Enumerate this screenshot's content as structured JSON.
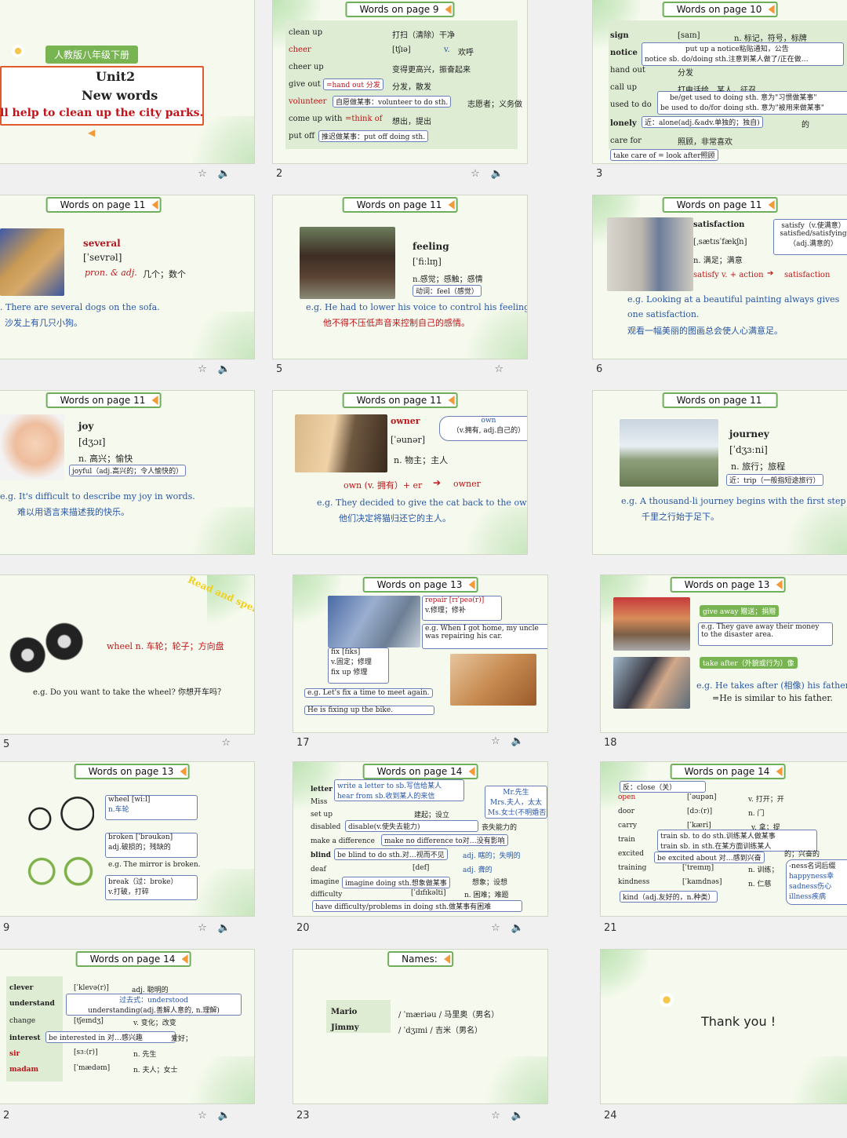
{
  "slides": {
    "s1": {
      "publisher": "人教版八年级下册",
      "unit": "Unit2",
      "sub": "New words",
      "headline": "ll help to clean up the city parks."
    },
    "s2": {
      "title": "Words on page 9",
      "num": "2",
      "w1": "clean up",
      "m1": "打扫（清除）干净",
      "w2": "cheer",
      "p2": "[tʃɪə]",
      "m2a": "v.",
      "m2": "欢呼",
      "w3": "cheer up",
      "m3": "变得更高兴，振奋起来",
      "w4": "give out",
      "b4": "=hand out 分发",
      "m4": "分发，散发",
      "w5": "volunteer",
      "b5": "自愿做某事：volunteer to do sth.",
      "m5": "志愿者；义务做",
      "w6": "come up with",
      "b6": "=think of",
      "m6": "想出，提出",
      "w7": "put off",
      "b7": "推迟做某事：put off doing sth."
    },
    "s3": {
      "title": "Words on page 10",
      "num": "3",
      "w1": "sign",
      "p1": "[saɪn]",
      "m1": "n. 标记，符号，标牌",
      "w2": "notice",
      "b2a": "put up a notice粘贴通知，公告",
      "b2b": "notice sb. do/doing sth.注意到某人做了/正在做…",
      "w3": "hand out",
      "m3": "分发",
      "w4": "call up",
      "m4": "打电话给…某人，征召",
      "w5": "used to do",
      "b5a": "be/get used to doing sth. 意为\"习惯做某事\"",
      "b5b": "be used to do/for doing sth. 意为\"被用来做某事\"",
      "w6": "lonely",
      "b6": "近：alone(adj.&adv.单独的；独自)",
      "m6": "的",
      "w7": "care for",
      "m7": "照顾，非常喜欢",
      "b8": "take care of = look after照顾"
    },
    "s4": {
      "title": "Words on page 11",
      "num": "",
      "word": "several",
      "phon": "[ˈsevrəl]",
      "pos": "pron. & adj.",
      "mean": "几个；数个",
      "eg": ". There are several dogs on the sofa.",
      "cn": "沙发上有几只小狗。"
    },
    "s5": {
      "title": "Words on page 11",
      "num": "5",
      "word": "feeling",
      "phon": "[ˈfiːlɪŋ]",
      "mean": "n.感觉；感触；感情",
      "box": "动词：feel（感觉）",
      "eg": "e.g. He had to lower his voice to control his feeling.",
      "cn": "他不得不压低声音来控制自己的感情。"
    },
    "s6": {
      "title": "Words on page 11",
      "num": "6",
      "word": "satisfaction",
      "phon": "[ˌsætɪsˈfækʃn]",
      "mean": "n. 满足；满意",
      "b1": "satisfy（v.使满意）",
      "b2": "satisfied/satisfying",
      "b3": "（adj.满意的）",
      "rule": "satisfy v. + action",
      "res": "satisfaction",
      "eg": "e.g. Looking at a beautiful painting always gives",
      "eg2": "one satisfaction.",
      "cn": "观看一幅美丽的图画总会使人心满意足。"
    },
    "s7": {
      "title": "Words on page 11",
      "num": "",
      "word": "joy",
      "phon": "[dʒɔɪ]",
      "mean": "n.  高兴；愉快",
      "box": "joyful（adj.高兴的；令人愉快的）",
      "eg": "e.g. It's difficult to describe my joy in words.",
      "cn": "难以用语言来描述我的快乐。"
    },
    "s8": {
      "title": "Words on page 11",
      "num": "",
      "word": "owner",
      "phon": "[ˈəunər]",
      "mean": "n.  物主；主人",
      "box1": "own",
      "box2": "（v.拥有, adj.自己的）",
      "rule": "own  (v. 拥有）+ er",
      "res": "owner",
      "eg": "e.g. They decided to give the cat back to the owner.",
      "cn": "他们决定将猫归还它的主人。"
    },
    "s9": {
      "title": "Words on page 11",
      "num": "",
      "word": "journey",
      "phon": "[ˈdʒɜːni]",
      "mean": "n.  旅行；旅程",
      "box": "近：trip（一般指短途旅行）",
      "eg": "e.g. A thousand-li journey begins with the first step",
      "cn": "千里之行始于足下。"
    },
    "s10": {
      "num": "5",
      "stamp": "Read and spell",
      "word": "wheel n. 车轮；轮子；方向盘",
      "eg": "e.g. Do you want to take the wheel? 你想开车吗？"
    },
    "s11": {
      "title": "Words on page 13",
      "num": "17",
      "b1": "repair [rɪˈpeə(r)]",
      "b1b": "v.修理；修补",
      "b2": "e.g. When I got home, my uncle",
      "b2b": "was repairing his car.",
      "b3a": "fix [fɪks]",
      "b3b": "v.固定；修理",
      "b3c": "fix up 修理",
      "b4": "e.g. Let's fix a time to meet again.",
      "b5": "He is fixing up the bike."
    },
    "s12": {
      "title": "Words on page 13",
      "num": "18",
      "b1": "give away 赠送；捐赠",
      "b2": "e.g. They gave away their money",
      "b2b": "to the disaster area.",
      "b3": "take after（外貌或行为）像",
      "eg": "e.g. He takes after (相像) his father",
      "eg2": "=He is similar to his father."
    },
    "s13": {
      "title": "Words on page 13",
      "num": "9",
      "b1a": "wheel [wiːl]",
      "b1b": "n.车轮",
      "b2a": "broken [ˈbrəukən]",
      "b2b": "adj.破损的；残缺的",
      "eg": "e.g. The mirror is broken.",
      "b3a": "break（过：broke）",
      "b3b": "v.打破，打碎"
    },
    "s14": {
      "title": "Words on page 14",
      "num": "20",
      "w1": "letter",
      "b1a": "write a letter to sb.写信给某人",
      "b1b": "hear from sb.收到某人的来信",
      "w2": "Miss",
      "b2a": "Mr.先生",
      "b2b": "Mrs.夫人，太太",
      "b2c": "Ms.女士(不明婚否)",
      "w3": "set up",
      "m3": "建起；设立",
      "w4": "disabled",
      "b4": "disable(v.使失去能力)",
      "m4": "丧失能力的",
      "w5": "make a difference",
      "b5": "make no difference to对…没有影响",
      "w6": "blind",
      "b6": "be blind to do sth.对…视而不见",
      "m6": "adj. 瞎的；失明的",
      "w7": "deaf",
      "p7": "[def]",
      "m7": "adj. 聋的",
      "w8": "imagine",
      "b8": "imagine doing sth.想象做某事",
      "m8": "想象；设想",
      "w9": "difficulty",
      "p9": "[ˈdɪfɪkəlti]",
      "m9": "n. 困难；难题",
      "b10": "have difficulty/problems in doing sth.做某事有困难"
    },
    "s15": {
      "title": "Words on page 14",
      "num": "21",
      "b0": "反：close（关）",
      "w1": "open",
      "p1": "[ˈəupən]",
      "m1": "v. 打开；开",
      "w2": "door",
      "p2": "[dɔː(r)]",
      "m2": "n. 门",
      "w3": "carry",
      "p3": "[ˈkæri]",
      "m3": "v. 拿；提",
      "w4": "train",
      "b4a": "train sb. to do sth.训练某人做某事",
      "b4b": "train sb. in sth.在某方面训练某人",
      "w5": "excited",
      "b5": "be excited about 对…感到兴奋",
      "m5": "的；兴奋的",
      "w6": "training",
      "p6": "[ˈtreɪnɪŋ]",
      "m6": "n. 训练；",
      "w7": "kindness",
      "p7": "[ˈkaɪndnəs]",
      "m7": "n. 仁慈",
      "b8": "kind（adj.友好的，n.种类）",
      "s1": "-ness名词后缀",
      "s2": "happyness幸",
      "s3": "sadness伤心",
      "s4": "illness疾病"
    },
    "s16": {
      "title": "Words on page 14",
      "num": "2",
      "w1": "clever",
      "p1": "[ˈklevə(r)]",
      "m1": "adj. 聪明的",
      "w2": "understand",
      "b2a": "过去式：understood",
      "b2b": "understanding(adj.善解人意的, n.理解)",
      "w3": "change",
      "p3": "[tʃeɪndʒ]",
      "m3": "v. 变化；改变",
      "w4": "interest",
      "b4": "be interested in 对…感兴趣",
      "m4": "爱好；",
      "w5": "sir",
      "p5": "[sɜː(r)]",
      "m5": "n. 先生",
      "w6": "madam",
      "p6": "[ˈmædəm]",
      "m6": "n. 夫人；女士"
    },
    "s17": {
      "title": "Names:",
      "num": "23",
      "w1": "Mario",
      "p1": "/ ˈmæriəu /  马里奥（男名）",
      "w2": "Jimmy",
      "p2": "/ ˈdʒɪmi /  吉米（男名）"
    },
    "s18": {
      "num": "24",
      "text": "Thank you !"
    }
  }
}
